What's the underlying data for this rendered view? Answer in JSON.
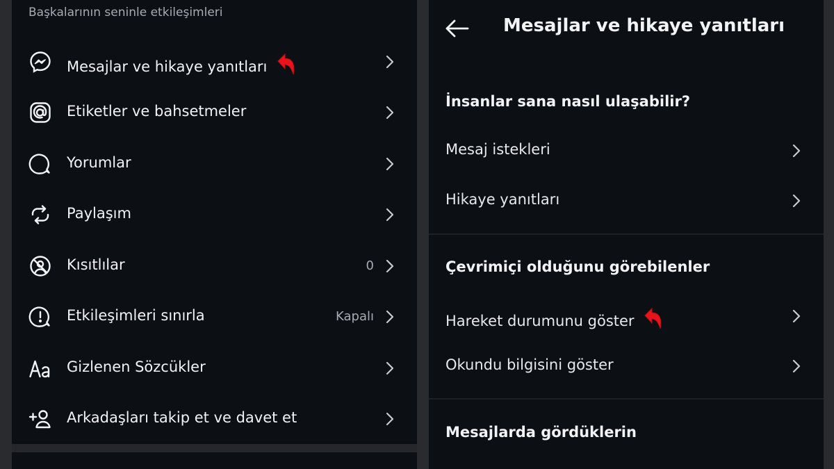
{
  "left": {
    "section_heading": "Başkalarının seninle etkileşimleri",
    "items": [
      {
        "label": "Mesajlar ve hikaye yanıtları",
        "value": "",
        "icon": "messenger-icon"
      },
      {
        "label": "Etiketler ve bahsetmeler",
        "value": "",
        "icon": "at-sign-icon"
      },
      {
        "label": "Yorumlar",
        "value": "",
        "icon": "comment-icon"
      },
      {
        "label": "Paylaşım",
        "value": "",
        "icon": "share-loop-icon"
      },
      {
        "label": "Kısıtlılar",
        "value": "0",
        "icon": "restricted-icon"
      },
      {
        "label": "Etkileşimleri sınırla",
        "value": "Kapalı",
        "icon": "alert-bubble-icon"
      },
      {
        "label": "Gizlenen Sözcükler",
        "value": "",
        "icon": "text-aa-icon"
      },
      {
        "label": "Arkadaşları takip et ve davet et",
        "value": "",
        "icon": "add-person-icon"
      }
    ]
  },
  "right": {
    "title": "Mesajlar ve hikaye yanıtları",
    "sections": [
      {
        "heading": "İnsanlar sana nasıl ulaşabilir?",
        "items": [
          "Mesaj istekleri",
          "Hikaye yanıtları"
        ]
      },
      {
        "heading": "Çevrimiçi olduğunu görebilenler",
        "items": [
          "Hareket durumunu göster",
          "Okundu bilgisini göster"
        ]
      },
      {
        "heading": "Mesajlarda gördüklerin",
        "items": []
      }
    ]
  },
  "colors": {
    "panel_bg": "#0c0f14",
    "gutter_bg": "#2a2b2f",
    "text_primary": "#f2f3f5",
    "text_secondary": "#a8acb3",
    "highlight_arrow": "#e8141b"
  }
}
